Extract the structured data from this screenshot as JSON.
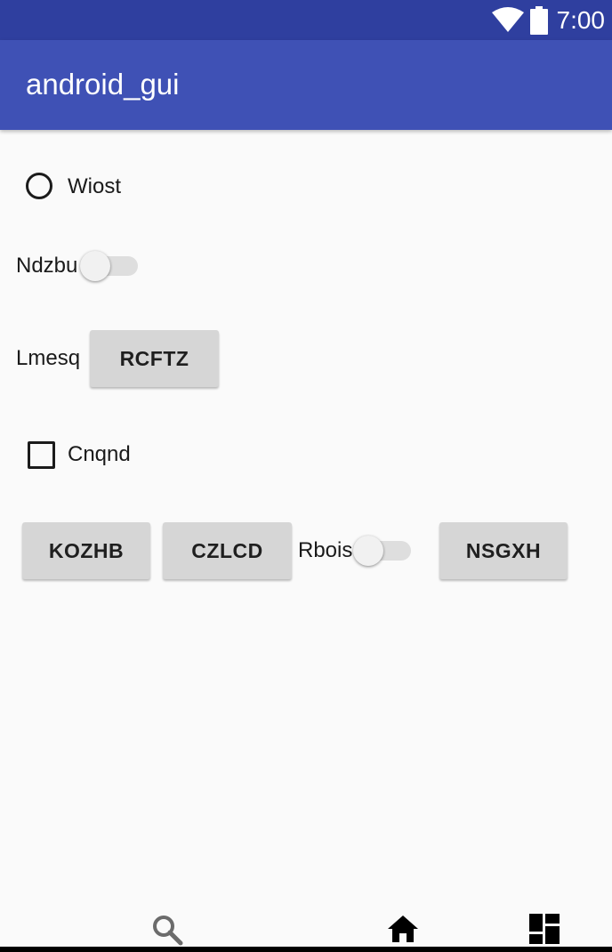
{
  "status_bar": {
    "time": "7:00",
    "icons": [
      "wifi-icon",
      "battery-icon"
    ]
  },
  "app_bar": {
    "title": "android_gui"
  },
  "controls": {
    "radio_label": "Wiost",
    "switch1_label": "Ndzbu",
    "lmesq_label": "Lmesq",
    "rcftz_button": "RCFTZ",
    "checkbox_label": "Cnqnd",
    "kozhb_button": "KOZHB",
    "czlcd_button": "CZLCD",
    "switch2_label": "Rbois",
    "nsgxh_button": "NSGXH"
  },
  "states": {
    "radio_checked": false,
    "checkbox_checked": false,
    "switch1_on": false,
    "switch2_on": false
  },
  "nav_bar": {
    "icons": [
      "search-icon",
      "home-icon",
      "dashboard-icon"
    ]
  },
  "colors": {
    "status_bar": "#2f3f9f",
    "app_bar": "#3f51b5",
    "background": "#fafafa",
    "button": "#d6d6d6"
  }
}
